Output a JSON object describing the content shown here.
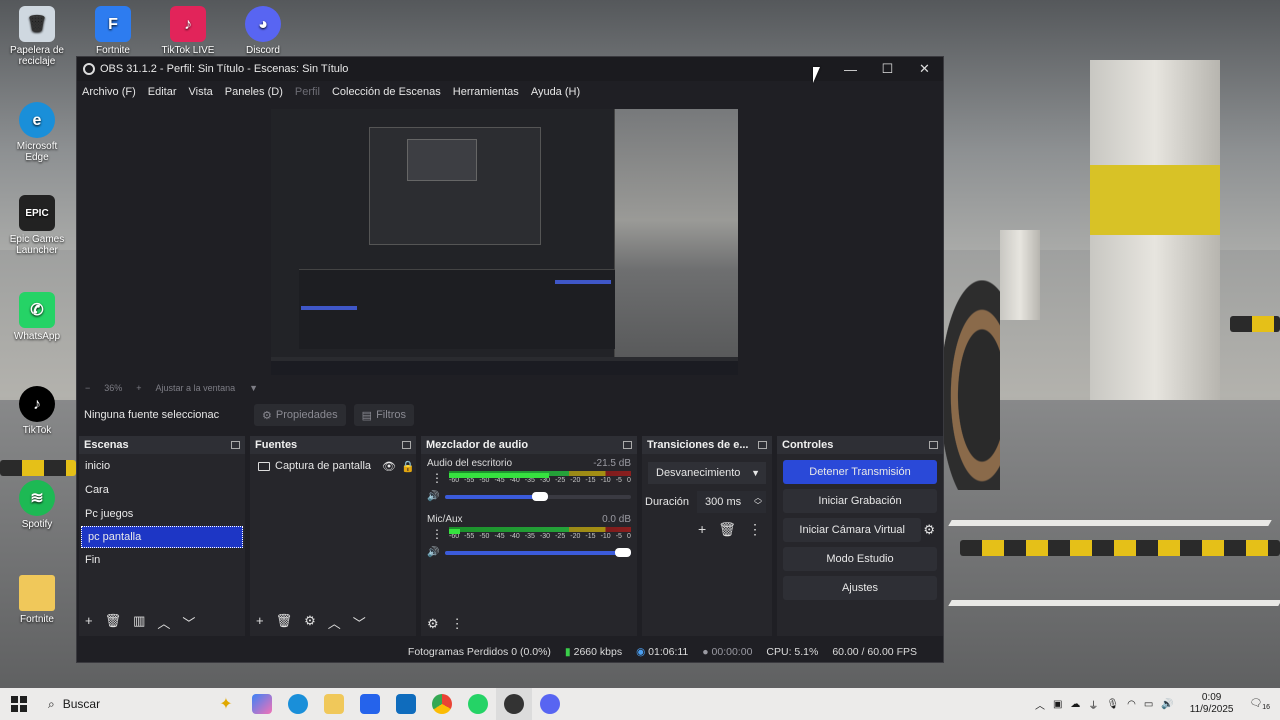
{
  "desktop": {
    "icons": [
      {
        "label": "Papelera de reciclaje",
        "icon": "recycle-bin-icon"
      },
      {
        "label": "Fortnite",
        "icon": "fortnite-icon"
      },
      {
        "label": "TikTok LIVE",
        "icon": "tiktok-live-icon"
      },
      {
        "label": "Discord",
        "icon": "discord-icon"
      },
      {
        "label": "Microsoft Edge",
        "icon": "edge-icon"
      },
      {
        "label": "Epic Games Launcher",
        "icon": "epic-games-icon"
      },
      {
        "label": "WhatsApp",
        "icon": "whatsapp-icon"
      },
      {
        "label": "TikTok",
        "icon": "tiktok-icon"
      },
      {
        "label": "Spotify",
        "icon": "spotify-icon"
      },
      {
        "label": "Fortnite",
        "icon": "folder-icon"
      }
    ]
  },
  "obs": {
    "title": "OBS 31.1.2 - Perfil: Sin Título - Escenas: Sin Título",
    "menu": [
      "Archivo (F)",
      "Editar",
      "Vista",
      "Paneles (D)",
      "Perfil",
      "Colección de Escenas",
      "Herramientas",
      "Ayuda (H)"
    ],
    "zoom": {
      "minus": "−",
      "value": "36%",
      "plus": "+",
      "fit": "Ajustar a la ventana"
    },
    "props": {
      "no_selection": "Ninguna fuente seleccionac",
      "properties": "Propiedades",
      "filters": "Filtros"
    },
    "scenes": {
      "title": "Escenas",
      "items": [
        "inicio",
        "Cara",
        "Pc juegos",
        "pc pantalla",
        "Fin"
      ],
      "selected": "pc pantalla"
    },
    "sources": {
      "title": "Fuentes",
      "items": [
        "Captura de pantalla"
      ]
    },
    "mixer": {
      "title": "Mezclador de audio",
      "channels": [
        {
          "name": "Audio del escritorio",
          "db": "-21.5 dB",
          "level": 0.55,
          "volume": 0.55
        },
        {
          "name": "Mic/Aux",
          "db": "0.0 dB",
          "level": 0.06,
          "volume": 1.0
        }
      ],
      "scale": [
        "-60",
        "-55",
        "-50",
        "-45",
        "-40",
        "-35",
        "-30",
        "-25",
        "-20",
        "-15",
        "-10",
        "-5",
        "0"
      ]
    },
    "transitions": {
      "title": "Transiciones de e...",
      "selected": "Desvanecimiento",
      "duration_label": "Duración",
      "duration_value": "300 ms"
    },
    "controls": {
      "title": "Controles",
      "buttons": [
        "Detener Transmisión",
        "Iniciar Grabación",
        "Iniciar Cámara Virtual",
        "Modo Estudio",
        "Ajustes"
      ]
    },
    "status": {
      "dropped": "Fotogramas Perdidos 0 (0.0%)",
      "bitrate": "2660 kbps",
      "stream_time": "01:06:11",
      "rec_time": "00:00:00",
      "cpu": "CPU: 5.1%",
      "fps": "60.00 / 60.00 FPS"
    }
  },
  "taskbar": {
    "search": "Buscar",
    "time": "0:09",
    "date": "11/9/2025",
    "notification_count": "16"
  },
  "colors": {
    "accent": "#2a49d8",
    "selected": "#1d36c5",
    "panel": "#26262b",
    "window": "#1f1f24"
  }
}
